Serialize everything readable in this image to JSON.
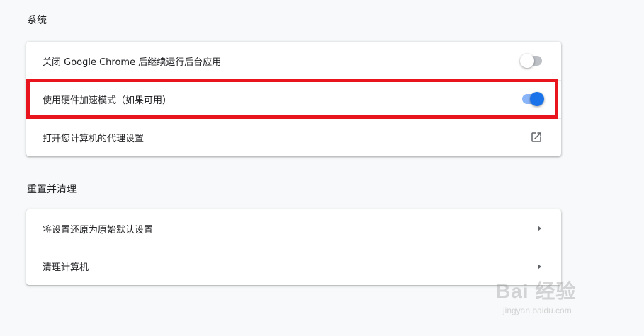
{
  "system_section": {
    "title": "系统",
    "rows": [
      {
        "label": "关闭 Google Chrome 后继续运行后台应用",
        "control": "toggle",
        "state": "off"
      },
      {
        "label": "使用硬件加速模式（如果可用）",
        "control": "toggle",
        "state": "on"
      },
      {
        "label": "打开您计算机的代理设置",
        "control": "external-link",
        "icon": "open-in-new-icon"
      }
    ]
  },
  "reset_section": {
    "title": "重置并清理",
    "rows": [
      {
        "label": "将设置还原为原始默认设置",
        "control": "arrow",
        "icon": "arrow-right-icon"
      },
      {
        "label": "清理计算机",
        "control": "arrow",
        "icon": "arrow-right-icon"
      }
    ]
  },
  "watermark": {
    "logo": "Bai 经验",
    "url": "jingyan.baidu.com"
  },
  "colors": {
    "accent": "#1a73e8",
    "toggle_on_bar": "#8ab4f8",
    "highlight": "#e8141e",
    "background": "#f8f9fa"
  }
}
